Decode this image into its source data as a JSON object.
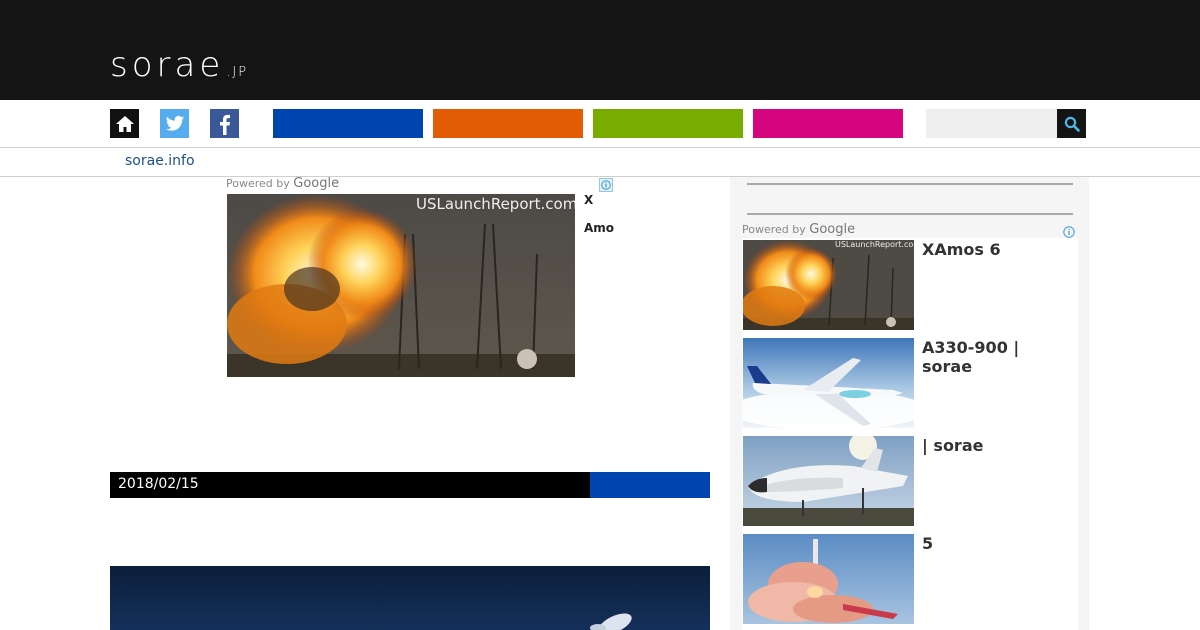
{
  "header": {
    "logo_main": "sorae",
    "logo_suffix": ".JP"
  },
  "nav": {
    "icons": [
      "home-icon",
      "twitter-icon",
      "facebook-icon"
    ],
    "category_colors": [
      "#0044b0",
      "#e15c04",
      "#78ad00",
      "#d4057f"
    ],
    "search_placeholder": "",
    "search_icon": "search-icon"
  },
  "subbar": {
    "link": "sorae.info"
  },
  "ad_main": {
    "powered_by": "Powered by",
    "google": "Google",
    "image_watermark": "USLaunchReport.com",
    "line1": "X",
    "line2": "Amo"
  },
  "article": {
    "date": "2018/02/15",
    "category_color": "#0044b0"
  },
  "sidebar": {
    "powered_by": "Powered by",
    "google": "Google",
    "items": [
      {
        "title": "XAmos 6",
        "image": "rocket-explosion",
        "watermark": "USLaunchReport.com"
      },
      {
        "title": "A330-900 | sorae",
        "image": "airbus-a330neo"
      },
      {
        "title": " | sorae",
        "image": "dream-chaser-spaceplane"
      },
      {
        "title": "5",
        "image": "rocket-launch"
      }
    ]
  }
}
